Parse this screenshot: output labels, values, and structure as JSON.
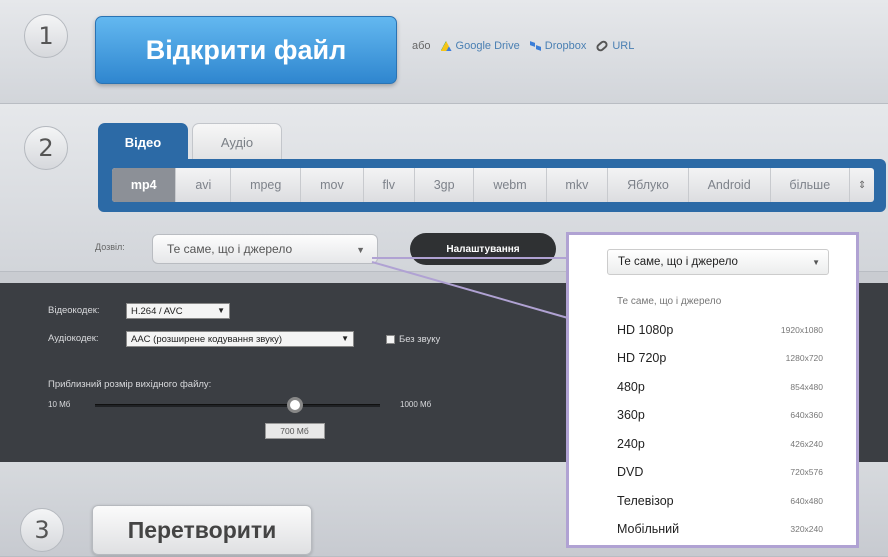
{
  "steps": {
    "one": "1",
    "two": "2",
    "three": "3"
  },
  "open": {
    "button_label": "Відкрити файл",
    "or_label": "або",
    "sources": [
      {
        "label": "Google Drive",
        "icon": "google-drive-icon"
      },
      {
        "label": "Dropbox",
        "icon": "dropbox-icon"
      },
      {
        "label": "URL",
        "icon": "link-icon"
      }
    ]
  },
  "tabs": {
    "video": "Відео",
    "audio": "Аудіо"
  },
  "formats": [
    "mp4",
    "avi",
    "mpeg",
    "mov",
    "flv",
    "3gp",
    "webm",
    "mkv",
    "Яблуко",
    "Android",
    "більше"
  ],
  "selected_format": "mp4",
  "resolution": {
    "label": "Дозвіл:",
    "value": "Те саме, що і джерело",
    "settings_label": "Налаштування"
  },
  "settings": {
    "video_codec_label": "Відеокодек:",
    "video_codec_value": "H.264 / AVC",
    "audio_codec_label": "Аудіокодек:",
    "audio_codec_value": "AAC (розширене кодування звуку)",
    "no_sound_label": "Без звуку",
    "size_label": "Приблизний розмір вихідного файлу:",
    "size_min": "10 Мб",
    "size_max": "1000 Мб",
    "size_current": "700 Мб",
    "size_fraction": 0.7
  },
  "convert": {
    "button_label": "Перетворити"
  },
  "dropdown": {
    "selected": "Те саме, що і джерело",
    "options": [
      {
        "name": "Те саме, що і джерело",
        "size": ""
      },
      {
        "name": "HD 1080p",
        "size": "1920x1080"
      },
      {
        "name": "HD 720p",
        "size": "1280x720"
      },
      {
        "name": "480p",
        "size": "854x480"
      },
      {
        "name": "360p",
        "size": "640x360"
      },
      {
        "name": "240p",
        "size": "426x240"
      },
      {
        "name": "DVD",
        "size": "720x576"
      },
      {
        "name": "Телевізор",
        "size": "640x480"
      },
      {
        "name": "Мобільний",
        "size": "320x240"
      }
    ]
  },
  "colors": {
    "accent_blue": "#2c6aa6",
    "button_blue": "#3b95dd",
    "dark_panel": "#3b3e43",
    "popup_border": "#b0a2d3"
  }
}
